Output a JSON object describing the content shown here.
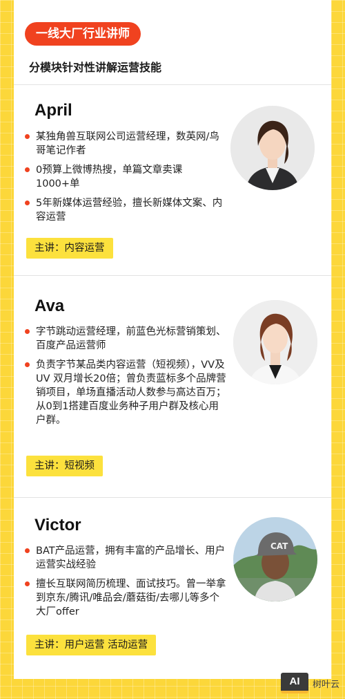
{
  "header": {
    "badge": "一线大厂行业讲师",
    "subtitle": "分模块针对性讲解运营技能"
  },
  "instructors": [
    {
      "name": "April",
      "bullets": [
        "某独角兽互联网公司运营经理，数英网/鸟哥笔记作者",
        "0预算上微博热搜，单篇文章卖课1000+单",
        "5年新媒体运营经验，擅长新媒体文案、内容运营"
      ],
      "tag": "主讲：内容运营"
    },
    {
      "name": "Ava",
      "bullets": [
        "字节跳动运营经理，前蓝色光标营销策划、百度产品运营师",
        "负责字节某品类内容运营（短视频），VV及UV 双月增长20倍；曾负责蓝标多个品牌营销项目，单场直播活动人数参与高达百万；从0到1搭建百度业务种子用户群及核心用户群。"
      ],
      "tag": "主讲：短视频"
    },
    {
      "name": "Victor",
      "bullets": [
        "BAT产品运营，拥有丰富的产品增长、用户运营实战经验",
        "擅长互联网简历梳理、面试技巧。曾一举拿到京东/腾讯/唯品会/蘑菇街/去哪儿等多个大厂offer"
      ],
      "tag": "主讲：用户运营 活动运营"
    }
  ],
  "watermark": {
    "logo": "AI",
    "text": "树叶云"
  },
  "colors": {
    "background": "#fcd73a",
    "accent_red": "#f0421f",
    "tag_yellow": "#fce13d"
  }
}
